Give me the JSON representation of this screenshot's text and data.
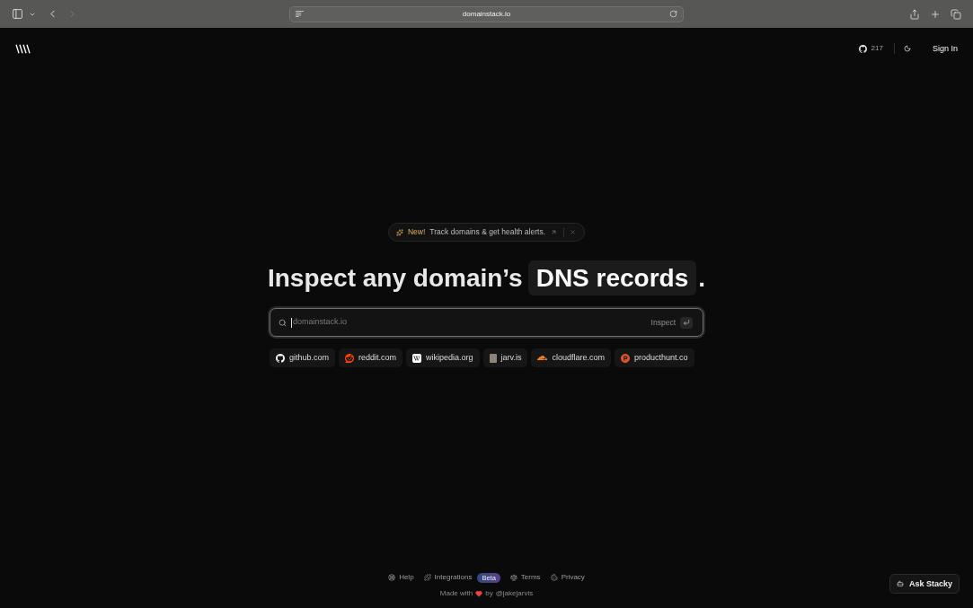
{
  "browser": {
    "url": "domainstack.io",
    "forward_disabled": true
  },
  "header": {
    "stars": "217",
    "sign_in": "Sign In"
  },
  "announcement": {
    "badge": "New!",
    "text": "Track domains & get health alerts."
  },
  "hero": {
    "title": "Inspect any domain’s",
    "highlight": "DNS records",
    "suffix": "."
  },
  "search": {
    "placeholder": "domainstack.io",
    "submit": "Inspect",
    "focused": true
  },
  "suggestions": [
    {
      "domain": "github.com",
      "kind": "cat",
      "color": "#ffffff"
    },
    {
      "domain": "reddit.com",
      "kind": "alien",
      "color": "#ff4500"
    },
    {
      "domain": "wikipedia.org",
      "kind": "serif",
      "color": "#ffffff"
    },
    {
      "domain": "jarv.is",
      "kind": "avatar",
      "color": "#8c8278"
    },
    {
      "domain": "cloudflare.com",
      "kind": "cloud",
      "color": "#f38020"
    },
    {
      "domain": "producthunt.co",
      "kind": "disc",
      "color": "#da552f"
    }
  ],
  "footer": {
    "links": [
      {
        "label": "Help",
        "kind": "lifebuoy"
      },
      {
        "label": "Integrations",
        "kind": "puzzle",
        "badge": "Beta"
      },
      {
        "label": "Terms",
        "kind": "scale"
      },
      {
        "label": "Privacy",
        "kind": "cookie"
      }
    ],
    "credit": {
      "prefix": "Made with",
      "by": "by",
      "author": "@jakejarvis"
    }
  },
  "assistant": {
    "label": "Ask Stacky"
  }
}
